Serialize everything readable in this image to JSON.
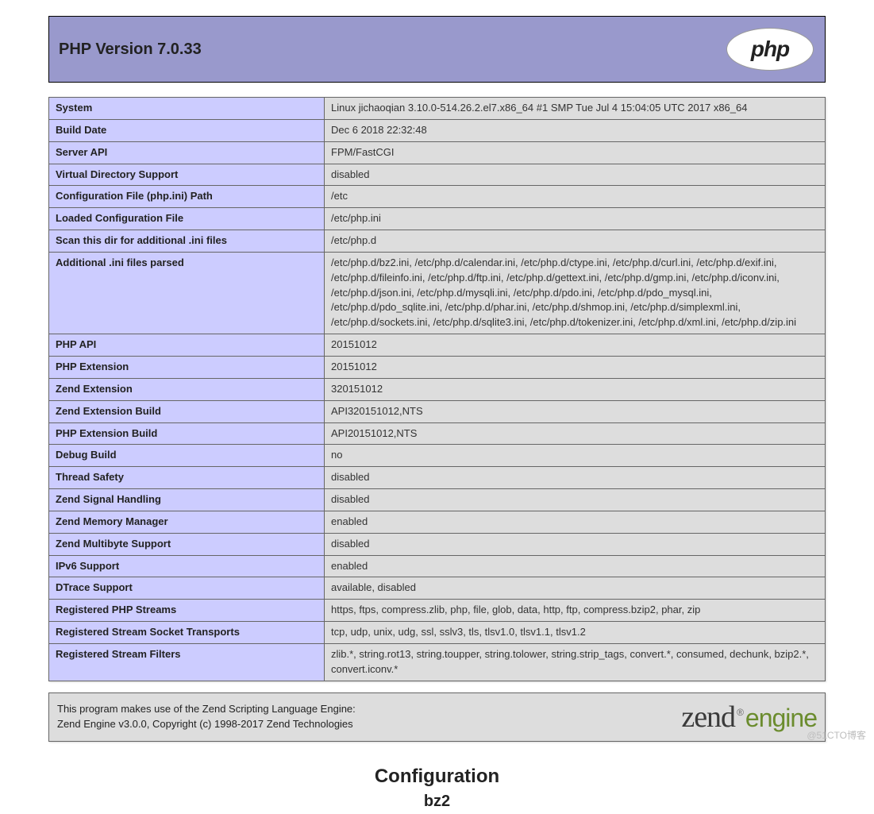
{
  "header": {
    "title": "PHP Version 7.0.33",
    "logo_text": "php"
  },
  "rows": [
    {
      "label": "System",
      "value": "Linux jichaoqian 3.10.0-514.26.2.el7.x86_64 #1 SMP Tue Jul 4 15:04:05 UTC 2017 x86_64"
    },
    {
      "label": "Build Date",
      "value": "Dec 6 2018 22:32:48"
    },
    {
      "label": "Server API",
      "value": "FPM/FastCGI"
    },
    {
      "label": "Virtual Directory Support",
      "value": "disabled"
    },
    {
      "label": "Configuration File (php.ini) Path",
      "value": "/etc"
    },
    {
      "label": "Loaded Configuration File",
      "value": "/etc/php.ini"
    },
    {
      "label": "Scan this dir for additional .ini files",
      "value": "/etc/php.d"
    },
    {
      "label": "Additional .ini files parsed",
      "value": "/etc/php.d/bz2.ini, /etc/php.d/calendar.ini, /etc/php.d/ctype.ini, /etc/php.d/curl.ini, /etc/php.d/exif.ini, /etc/php.d/fileinfo.ini, /etc/php.d/ftp.ini, /etc/php.d/gettext.ini, /etc/php.d/gmp.ini, /etc/php.d/iconv.ini, /etc/php.d/json.ini, /etc/php.d/mysqli.ini, /etc/php.d/pdo.ini, /etc/php.d/pdo_mysql.ini, /etc/php.d/pdo_sqlite.ini, /etc/php.d/phar.ini, /etc/php.d/shmop.ini, /etc/php.d/simplexml.ini, /etc/php.d/sockets.ini, /etc/php.d/sqlite3.ini, /etc/php.d/tokenizer.ini, /etc/php.d/xml.ini, /etc/php.d/zip.ini"
    },
    {
      "label": "PHP API",
      "value": "20151012"
    },
    {
      "label": "PHP Extension",
      "value": "20151012"
    },
    {
      "label": "Zend Extension",
      "value": "320151012"
    },
    {
      "label": "Zend Extension Build",
      "value": "API320151012,NTS"
    },
    {
      "label": "PHP Extension Build",
      "value": "API20151012,NTS"
    },
    {
      "label": "Debug Build",
      "value": "no"
    },
    {
      "label": "Thread Safety",
      "value": "disabled"
    },
    {
      "label": "Zend Signal Handling",
      "value": "disabled"
    },
    {
      "label": "Zend Memory Manager",
      "value": "enabled"
    },
    {
      "label": "Zend Multibyte Support",
      "value": "disabled"
    },
    {
      "label": "IPv6 Support",
      "value": "enabled"
    },
    {
      "label": "DTrace Support",
      "value": "available, disabled"
    },
    {
      "label": "Registered PHP Streams",
      "value": "https, ftps, compress.zlib, php, file, glob, data, http, ftp, compress.bzip2, phar, zip"
    },
    {
      "label": "Registered Stream Socket Transports",
      "value": "tcp, udp, unix, udg, ssl, sslv3, tls, tlsv1.0, tlsv1.1, tlsv1.2"
    },
    {
      "label": "Registered Stream Filters",
      "value": "zlib.*, string.rot13, string.toupper, string.tolower, string.strip_tags, convert.*, consumed, dechunk, bzip2.*, convert.iconv.*"
    }
  ],
  "zend": {
    "line1": "This program makes use of the Zend Scripting Language Engine:",
    "line2": "Zend Engine v3.0.0, Copyright (c) 1998-2017 Zend Technologies",
    "logo_zend": "zend",
    "logo_engine": "engine"
  },
  "section": {
    "title": "Configuration",
    "sub": "bz2"
  },
  "watermark": "@51CTO博客"
}
